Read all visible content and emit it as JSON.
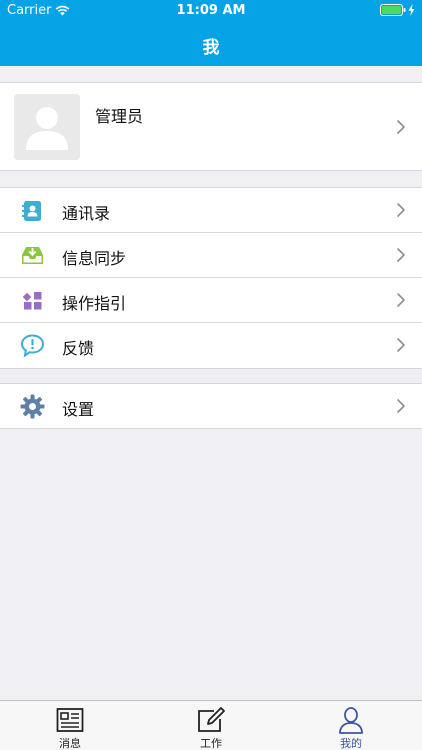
{
  "status_bar": {
    "carrier": "Carrier",
    "time": "11:09 AM"
  },
  "nav": {
    "title": "我"
  },
  "profile": {
    "name": "管理员"
  },
  "menu_group_1": [
    {
      "label": "通讯录",
      "icon": "contacts-icon"
    },
    {
      "label": "信息同步",
      "icon": "inbox-sync-icon"
    },
    {
      "label": "操作指引",
      "icon": "grid-guide-icon"
    },
    {
      "label": "反馈",
      "icon": "feedback-bubble-icon"
    }
  ],
  "menu_group_2": [
    {
      "label": "设置",
      "icon": "gear-icon"
    }
  ],
  "tabbar": {
    "tabs": [
      {
        "label": "消息",
        "icon": "newspaper-icon"
      },
      {
        "label": "工作",
        "icon": "edit-icon"
      },
      {
        "label": "我的",
        "icon": "person-icon",
        "active": true
      }
    ]
  },
  "colors": {
    "accent": "#05a3e6",
    "tab_active": "#3b54a5"
  }
}
